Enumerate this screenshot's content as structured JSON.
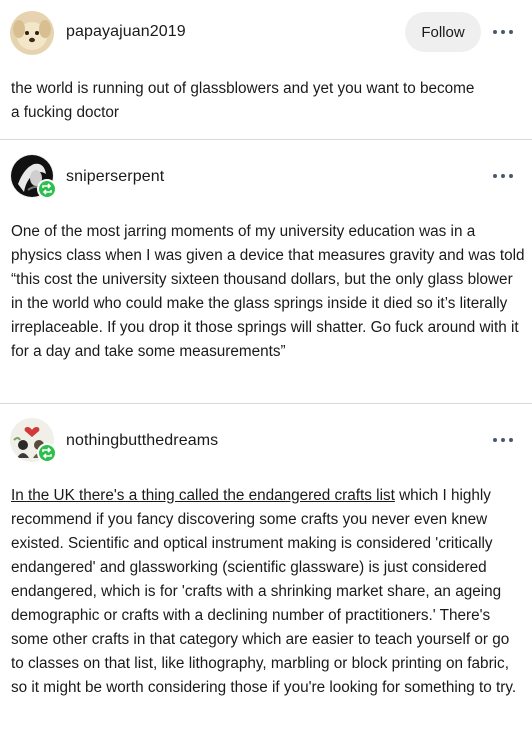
{
  "posts": [
    {
      "username": "papayajuan2019",
      "avatar_icon": "dog-avatar",
      "follow_label": "Follow",
      "more_icon": "ellipsis-icon",
      "text": "the world is running out of glassblowers and yet you want to become a fucking doctor"
    },
    {
      "username": "sniperserpent",
      "avatar_icon": "dark-figure-avatar",
      "badge_icon": "reblog-icon",
      "more_icon": "ellipsis-icon",
      "text": "One of the most jarring moments of my university education was in a physics class when I was given a device that measures gravity and was told “this cost the university sixteen thousand dollars, but the only glass blower in the world who could make the glass springs inside it died so it’s literally irreplaceable. If you drop it those springs will shatter. Go fuck around with it for a day and take some measurements”"
    },
    {
      "username": "nothingbutthedreams",
      "avatar_icon": "heart-couple-avatar",
      "badge_icon": "reblog-icon",
      "more_icon": "ellipsis-icon",
      "link_text": "In the UK there's a thing called the endangered crafts list",
      "text": " which I highly recommend if you fancy discovering some crafts you never even knew existed. Scientific and optical instrument making is considered 'critically endangered' and glassworking (scientific glassware) is just considered endangered, which is for 'crafts with a shrinking market share, an ageing demographic or crafts with a declining number of practitioners.' There's some other crafts in that category which are easier to teach yourself or go to classes on that list, like lithography, marbling or block printing on fabric, so it might be worth considering those if you're looking for something to try."
    }
  ],
  "colors": {
    "reblog_badge": "#2fbf4f",
    "follow_bg": "#efefef",
    "divider": "#d9d9d9",
    "dots": "#4a5a6e"
  }
}
